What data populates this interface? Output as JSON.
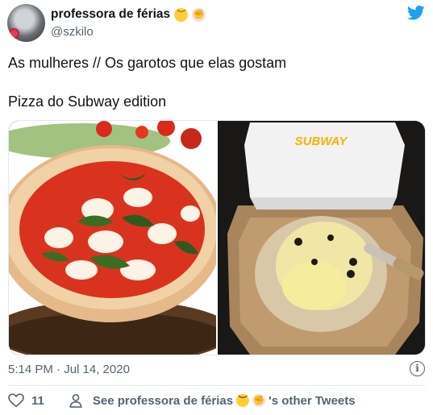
{
  "author": {
    "display_name": "professora de férias",
    "handle": "@szkilo",
    "emojis": [
      "sad-face-emoji",
      "raised-fist-emoji"
    ]
  },
  "tweet": {
    "line1": "As mulheres // Os garotos que elas gostam",
    "line2": "Pizza do Subway edition"
  },
  "media": {
    "left_image": "margherita-pizza-photo",
    "right_image": "subway-pizza-photo",
    "box_brand": "SUBWAY"
  },
  "meta": {
    "timestamp": "5:14 PM · Jul 14, 2020"
  },
  "footer": {
    "likes": "11",
    "see_prefix": "See professora de férias",
    "see_suffix": "'s other Tweets"
  },
  "colors": {
    "twitter_blue": "#1da1f2",
    "muted_text": "#536471"
  }
}
